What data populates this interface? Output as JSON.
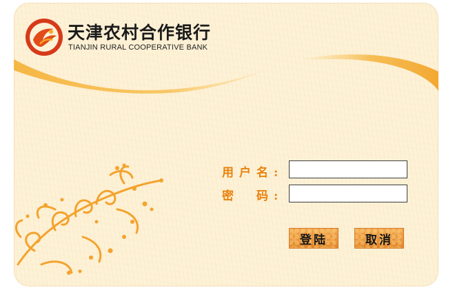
{
  "brand": {
    "name_cn": "天津农村合作银行",
    "name_en": "TIANJIN RURAL COOPERATIVE BANK"
  },
  "login": {
    "username_label": "用户名:",
    "password_label": "密　码:",
    "username_value": "",
    "password_value": "",
    "login_button": "登陆",
    "cancel_button": "取消"
  },
  "theme": {
    "background": "#fdf1d6",
    "accent": "#f3a32e",
    "label_color": "#e8820c",
    "logo_red": "#d63a1a"
  },
  "icons": [
    "bank-logo-icon",
    "floral-ornament"
  ]
}
